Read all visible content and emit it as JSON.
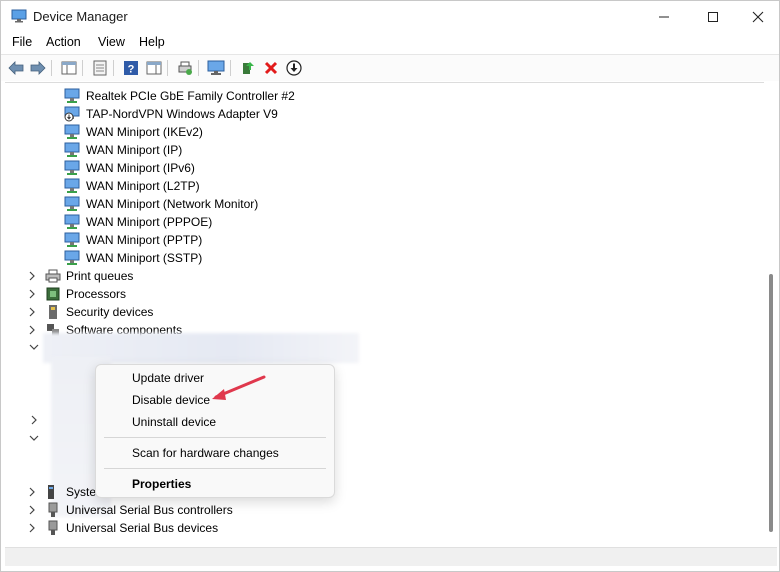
{
  "window": {
    "title": "Device Manager"
  },
  "menubar": {
    "file": "File",
    "action": "Action",
    "view": "View",
    "help": "Help"
  },
  "network_adapters": [
    {
      "label": "Realtek PCIe GbE Family Controller #2"
    },
    {
      "label": "TAP-NordVPN Windows Adapter V9"
    },
    {
      "label": "WAN Miniport (IKEv2)"
    },
    {
      "label": "WAN Miniport (IP)"
    },
    {
      "label": "WAN Miniport (IPv6)"
    },
    {
      "label": "WAN Miniport (L2TP)"
    },
    {
      "label": "WAN Miniport (Network Monitor)"
    },
    {
      "label": "WAN Miniport (PPPOE)"
    },
    {
      "label": "WAN Miniport (PPTP)"
    },
    {
      "label": "WAN Miniport (SSTP)"
    }
  ],
  "categories": [
    {
      "label": "Print queues",
      "icon": "printer-icon"
    },
    {
      "label": "Processors",
      "icon": "processor-icon"
    },
    {
      "label": "Security devices",
      "icon": "security-device-icon"
    },
    {
      "label": "Software components",
      "icon": "software-component-icon"
    }
  ],
  "bottom_categories": [
    {
      "label": "Syste",
      "icon": "system-devices-icon"
    },
    {
      "label": "Universal Serial Bus controllers",
      "icon": "usb-icon"
    },
    {
      "label": "Universal Serial Bus devices",
      "icon": "usb-icon"
    }
  ],
  "context_menu": {
    "update": "Update driver",
    "disable": "Disable device",
    "uninstall": "Uninstall device",
    "scan": "Scan for hardware changes",
    "properties": "Properties"
  },
  "annotation": {
    "color": "#e0384d"
  }
}
